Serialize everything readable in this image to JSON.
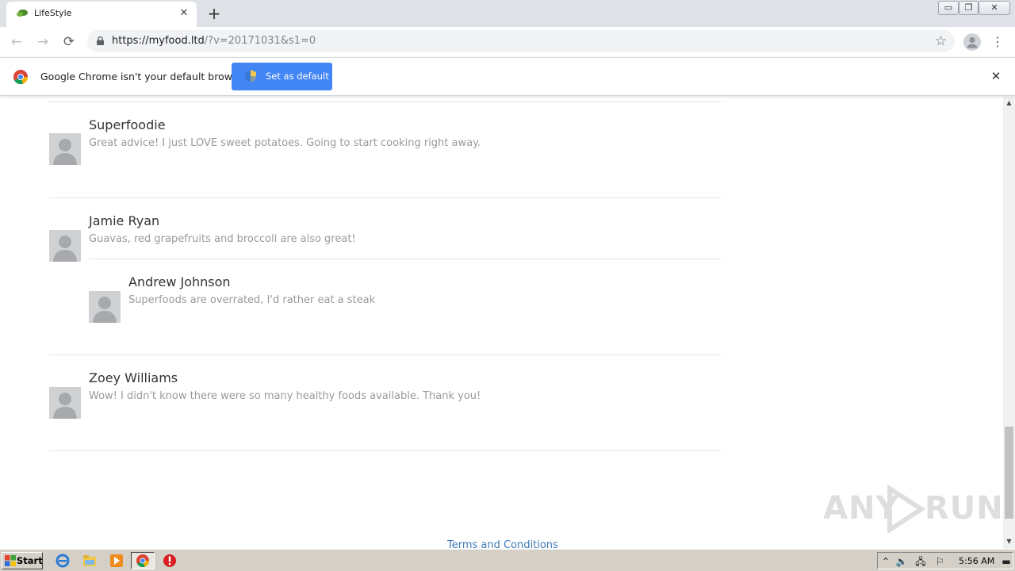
{
  "browser": {
    "tab_title": "LifeStyle",
    "tab_close_glyph": "✕",
    "new_tab_glyph": "+",
    "url_host": "https://myfood.ltd",
    "url_rest": "/?v=20171031&s1=0",
    "star_glyph": "☆",
    "menu_glyph": "⋮",
    "back_glyph": "←",
    "forward_glyph": "→",
    "reload_glyph": "⟳"
  },
  "infobar": {
    "message": "Google Chrome isn't your default browser",
    "button_label": "Set as default",
    "close_glyph": "✕"
  },
  "comments": [
    {
      "name": "Superfoodie",
      "text": "Great advice! I just LOVE sweet potatoes. Going to start cooking right away."
    },
    {
      "name": "Jamie Ryan",
      "text": "Guavas, red grapefruits and broccoli are also great!"
    },
    {
      "name": "Andrew Johnson",
      "text": "Superfoods are overrated, I'd rather eat a steak"
    },
    {
      "name": "Zoey Williams",
      "text": "Wow! I didn't know there were so many healthy foods available. Thank you!"
    }
  ],
  "footer": {
    "terms_link": "Terms and Conditions"
  },
  "watermark": {
    "left": "ANY",
    "right": "RUN"
  },
  "taskbar": {
    "start_label": "Start",
    "clock": "5:56 AM"
  },
  "colors": {
    "infobar_button": "#4285f4",
    "link": "#3d7ab8",
    "comment_text": "#9a9a9a",
    "name_text": "#333333"
  }
}
